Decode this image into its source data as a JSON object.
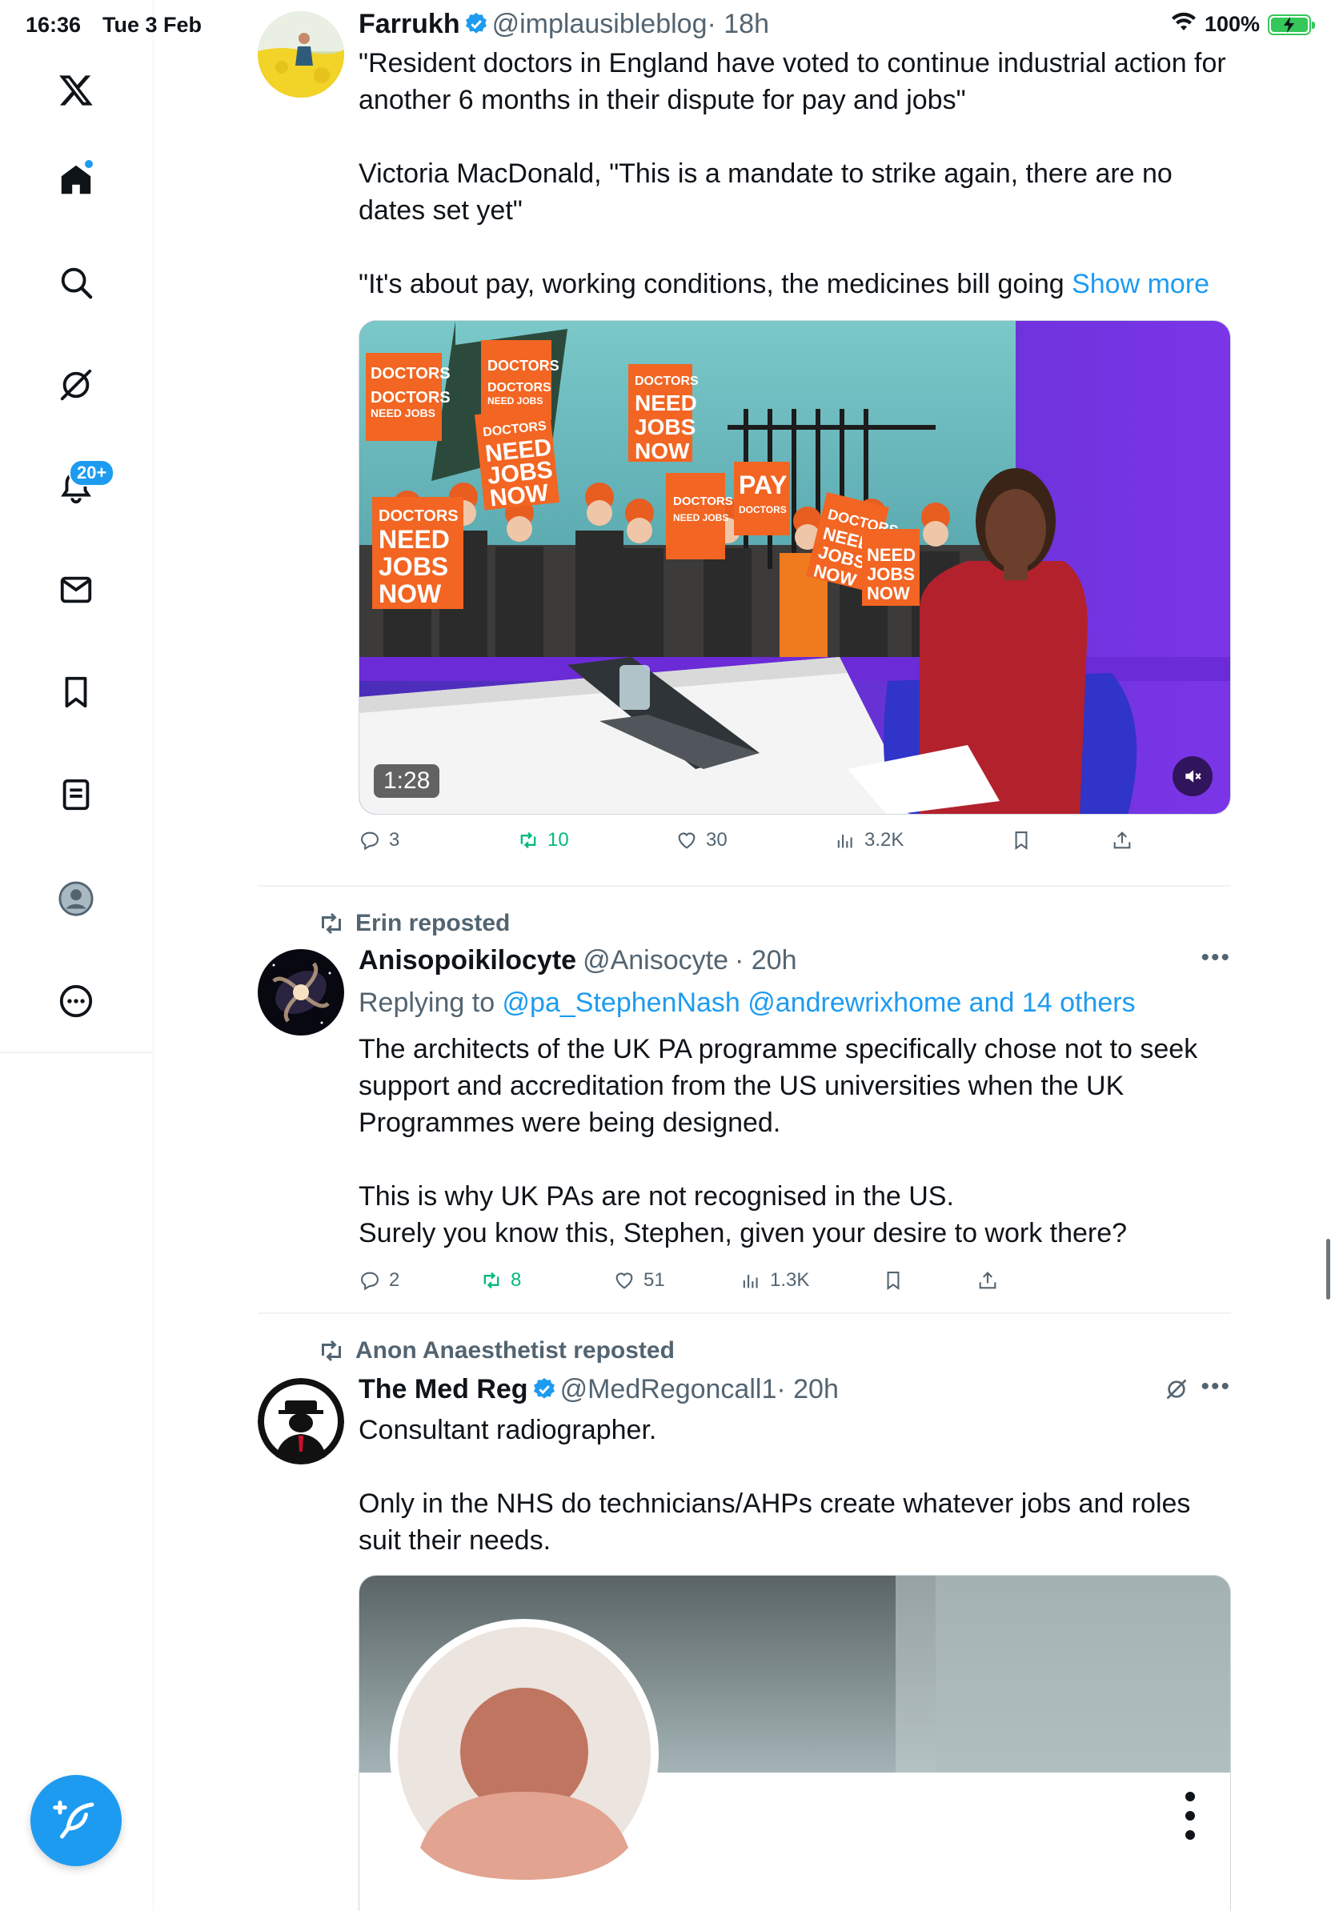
{
  "status_bar": {
    "time": "16:36",
    "date": "Tue 3 Feb",
    "battery": "100%"
  },
  "sidebar": {
    "items": [
      {
        "name": "x-logo-icon"
      },
      {
        "name": "home-icon"
      },
      {
        "name": "search-icon"
      },
      {
        "name": "grok-icon"
      },
      {
        "name": "notifications-icon",
        "badge": "20+"
      },
      {
        "name": "messages-icon"
      },
      {
        "name": "bookmarks-icon"
      },
      {
        "name": "lists-icon"
      },
      {
        "name": "profile-icon"
      },
      {
        "name": "more-icon"
      }
    ],
    "compose": {
      "name": "compose-icon"
    }
  },
  "posts": [
    {
      "author": "Farrukh",
      "handle": "@implausibleblog",
      "time": "· 18h",
      "verified": true,
      "text_1": "\"Resident doctors in England have voted to continue industrial action for another 6 months in their dispute for pay and jobs\"",
      "text_2": "Victoria MacDonald, \"This is a mandate to strike again, there are no dates set yet\"",
      "text_3": "\"It's about pay, working conditions, the medicines bill going ",
      "show_more": "Show more",
      "video": {
        "duration": "1:28",
        "placards": [
          "DOCTORS NEED JOBS",
          "DOCTORS NEED JOBS NOW",
          "PAY DOCTORS",
          "DOCTORS NEED JOBS NOW"
        ]
      },
      "replies": "3",
      "reposts": "10",
      "likes": "30",
      "views": "3.2K"
    },
    {
      "reposted_by": "Erin reposted",
      "author": "Anisopoikilocyte",
      "handle": "@Anisocyte",
      "time": "· 20h",
      "replying_prefix": "Replying to ",
      "replying_to": "@pa_StephenNash @andrewrixhome and 14 others",
      "text_1": "The architects of the UK PA programme specifically chose not to seek support and accreditation from the US universities when the UK Programmes were being designed.",
      "text_2": "This is why UK PAs are not recognised in the US.\nSurely you know this, Stephen, given your desire to work there?",
      "replies": "2",
      "reposts": "8",
      "likes": "51",
      "views": "1.3K"
    },
    {
      "reposted_by": "Anon Anaesthetist reposted",
      "author": "The Med Reg",
      "handle": "@MedRegoncall1",
      "time": "· 20h",
      "verified": true,
      "text_1": "Consultant radiographer.",
      "text_2": "Only in the NHS do technicians/AHPs create whatever jobs and roles suit their needs."
    }
  ],
  "colors": {
    "accent": "#1d9bf0",
    "repost_green": "#00ba7c",
    "muted": "#536471"
  }
}
